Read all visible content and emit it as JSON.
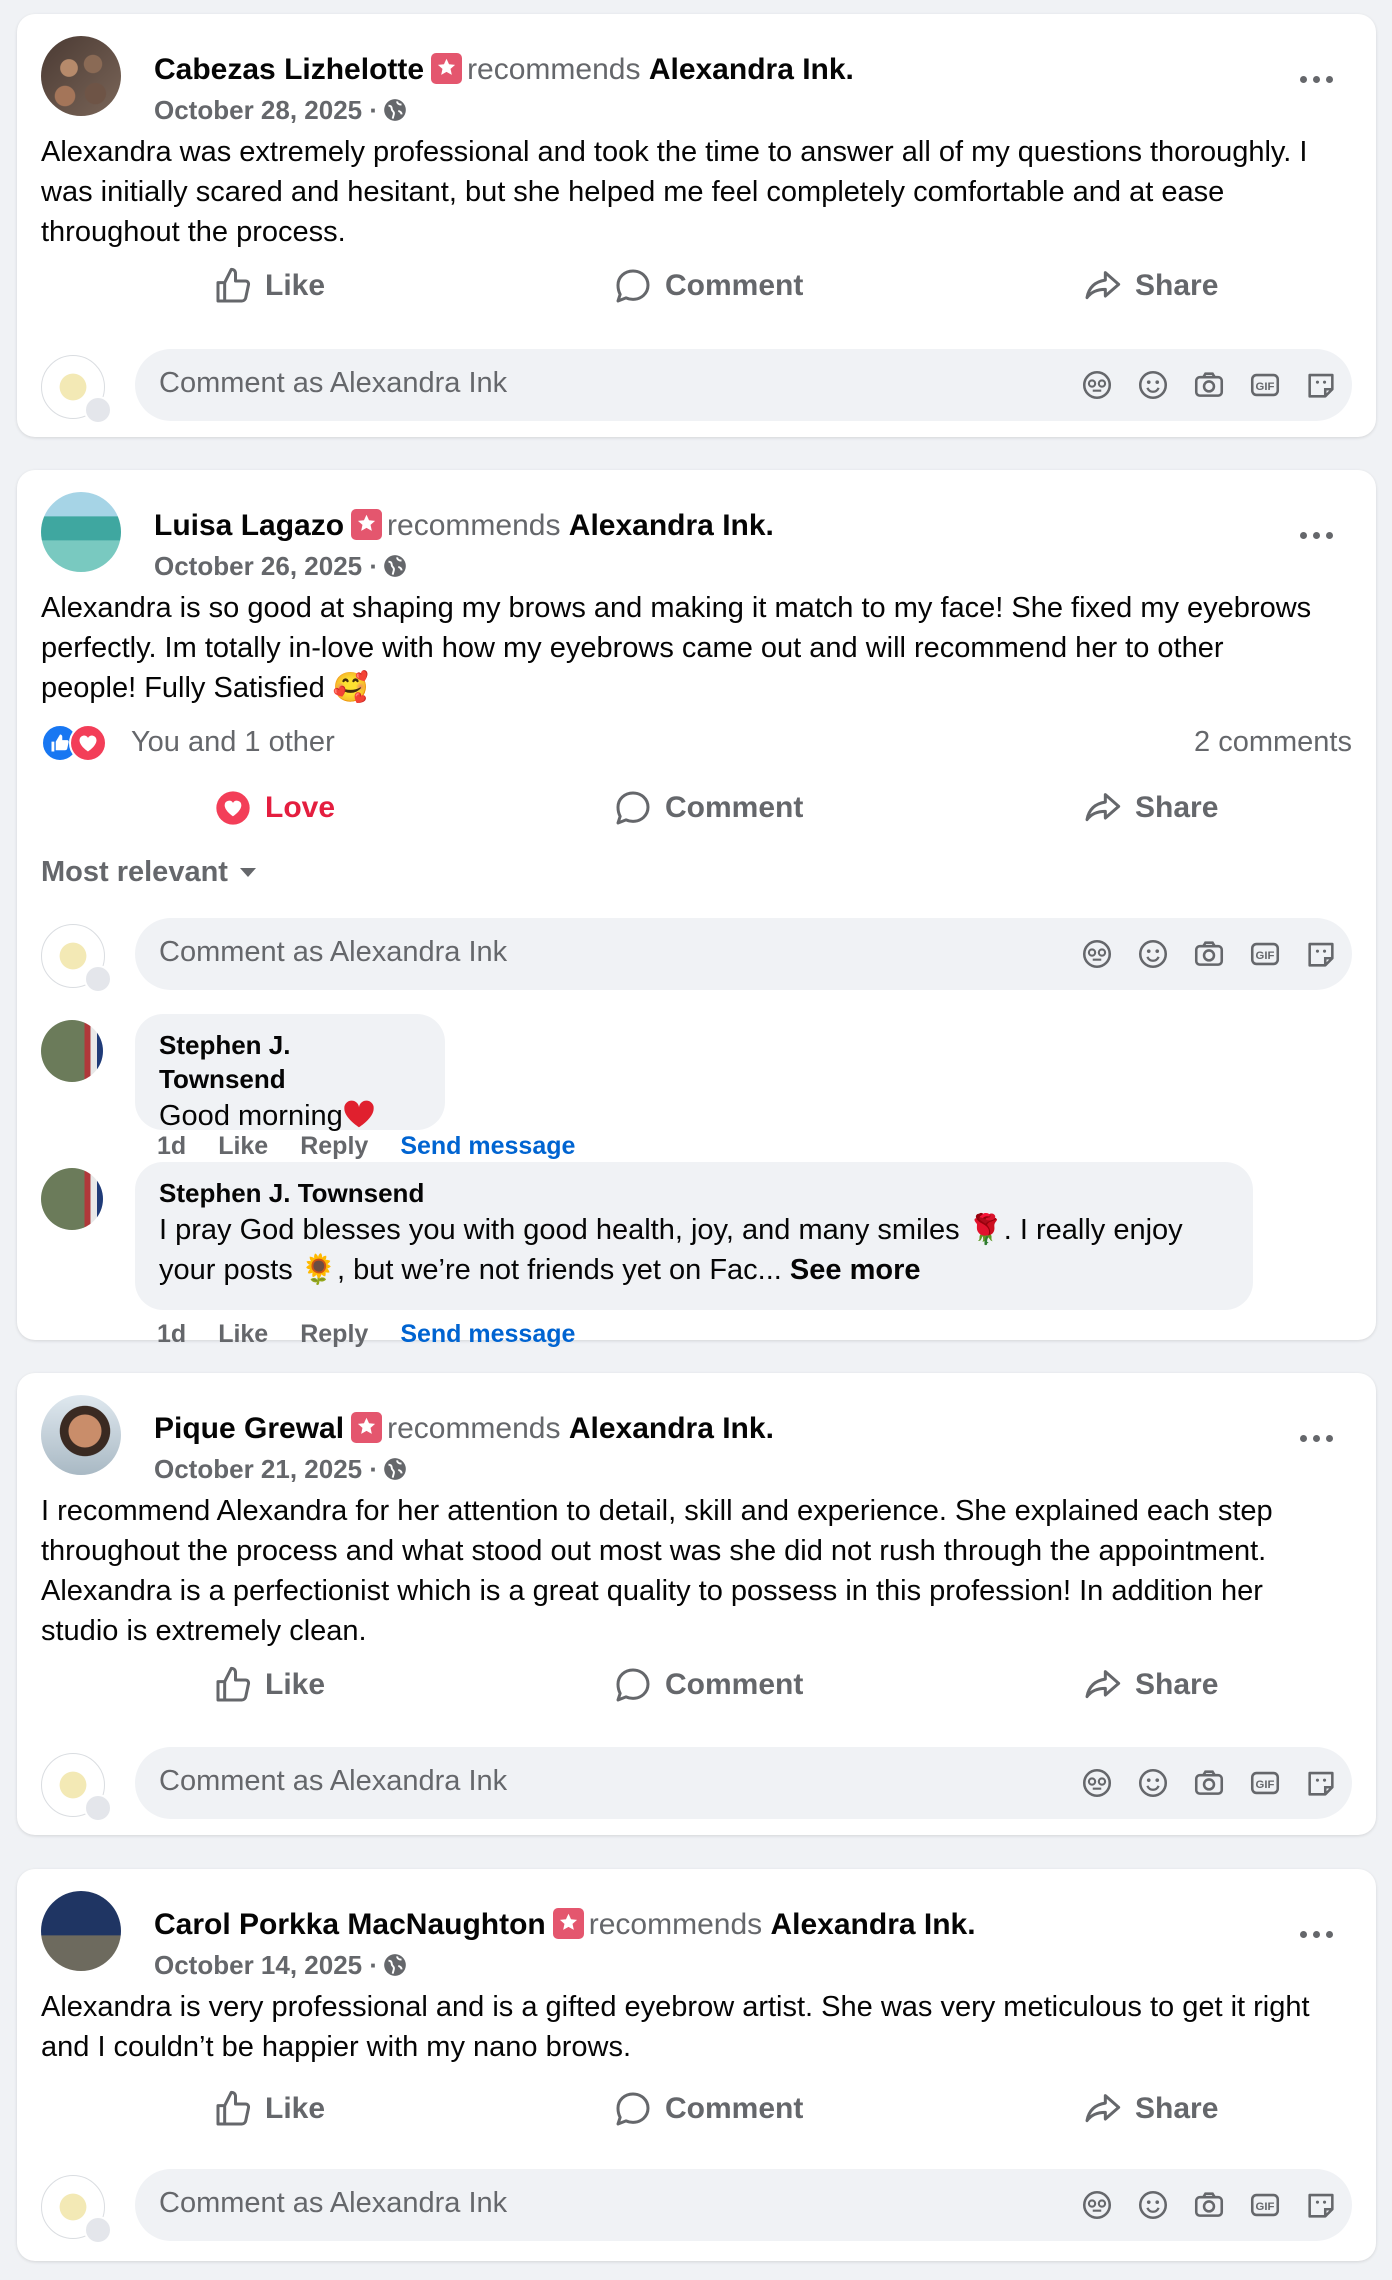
{
  "page_name": "Alexandra Ink",
  "recommends_word": "recommends",
  "colors": {
    "background": "#f0f2f5",
    "card": "#ffffff",
    "secondary_text": "#65676b",
    "recommend_badge": "#e4566e",
    "love": "#e41e3f",
    "link": "#0064d1"
  },
  "actions": {
    "like": "Like",
    "love": "Love",
    "comment": "Comment",
    "share": "Share"
  },
  "composer": {
    "placeholder": "Comment as Alexandra Ink",
    "icons": [
      "avatar-sticker-icon",
      "emoji-icon",
      "camera-icon",
      "gif-icon",
      "sticker-icon"
    ]
  },
  "posts": [
    {
      "author": "Cabezas Lizhelotte",
      "page": "Alexandra Ink.",
      "date": "October 28, 2025 ·",
      "text": "Alexandra was extremely professional and took the time to answer all of my questions thoroughly. I was initially scared and hesitant, but she helped me feel completely comfortable and at ease throughout the process."
    },
    {
      "author": "Luisa Lagazo",
      "page": "Alexandra Ink.",
      "date": "October 26, 2025 ·",
      "text": "Alexandra is so good at shaping my brows and making it match to my face! She fixed my eyebrows perfectly. Im totally in-love with how my eyebrows came out and will recommend her to other people! Fully Satisfied 🥰",
      "reactions": "You and 1 other",
      "comments_count": "2 comments",
      "sort_label": "Most relevant",
      "comments": [
        {
          "author": "Stephen J. Townsend",
          "text": "Good morning",
          "time": "1d",
          "like": "Like",
          "reply": "Reply",
          "send": "Send message"
        },
        {
          "author": "Stephen J. Townsend",
          "text": "I pray God blesses you with good health, joy, and many smiles 🌹. I really enjoy your posts 🌻, but we’re not friends yet on Fac...",
          "see_more": "See more",
          "time": "1d",
          "like": "Like",
          "reply": "Reply",
          "send": "Send message"
        }
      ]
    },
    {
      "author": "Pique Grewal",
      "page": "Alexandra Ink.",
      "date": "October 21, 2025 ·",
      "text": "I recommend Alexandra for her attention to detail, skill and experience. She explained each step throughout the process and what stood out most was she did not rush through the appointment. Alexandra is a perfectionist which is a great quality to possess in this profession! In addition her studio is extremely clean."
    },
    {
      "author": "Carol Porkka MacNaughton",
      "page": "Alexandra Ink.",
      "date": "October 14, 2025 ·",
      "text": "Alexandra is very professional and is a gifted eyebrow artist.  She was very meticulous to get it right and I couldn’t be happier with my nano brows."
    }
  ]
}
